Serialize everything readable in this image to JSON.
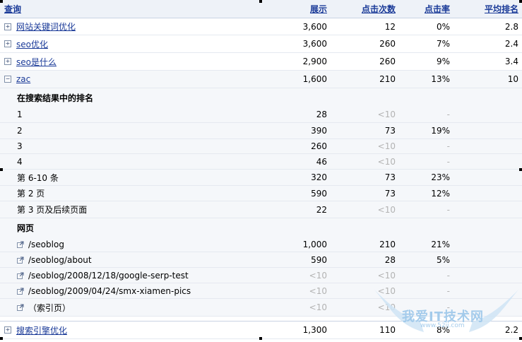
{
  "header": {
    "query": "查询",
    "impressions": "展示",
    "clicks": "点击次数",
    "ctr": "点击率",
    "avg_position": "平均排名"
  },
  "queries_top": [
    {
      "label": "网站关键词优化",
      "impressions": "3,600",
      "clicks": "12",
      "ctr": "0%",
      "avg": "2.8"
    },
    {
      "label": "seo优化",
      "impressions": "3,600",
      "clicks": "260",
      "ctr": "7%",
      "avg": "2.4"
    },
    {
      "label": "seo是什么",
      "impressions": "2,900",
      "clicks": "260",
      "ctr": "9%",
      "avg": "3.4"
    },
    {
      "label": "zac",
      "impressions": "1,600",
      "clicks": "210",
      "ctr": "13%",
      "avg": "10"
    }
  ],
  "ranking_section": {
    "title": "在搜索结果中的排名",
    "rows": [
      {
        "label": "1",
        "impressions": "28",
        "clicks": "<10",
        "ctr": "-"
      },
      {
        "label": "2",
        "impressions": "390",
        "clicks": "73",
        "ctr": "19%"
      },
      {
        "label": "3",
        "impressions": "260",
        "clicks": "<10",
        "ctr": "-"
      },
      {
        "label": "4",
        "impressions": "46",
        "clicks": "<10",
        "ctr": "-"
      },
      {
        "label": "第 6-10 条",
        "impressions": "320",
        "clicks": "73",
        "ctr": "23%"
      },
      {
        "label": "第 2 页",
        "impressions": "590",
        "clicks": "73",
        "ctr": "12%"
      },
      {
        "label": "第 3 页及后续页面",
        "impressions": "22",
        "clicks": "<10",
        "ctr": "-"
      }
    ]
  },
  "pages_section": {
    "title": "网页",
    "rows": [
      {
        "label": "/seoblog",
        "impressions": "1,000",
        "clicks": "210",
        "ctr": "21%"
      },
      {
        "label": "/seoblog/about",
        "impressions": "590",
        "clicks": "28",
        "ctr": "5%"
      },
      {
        "label": "/seoblog/2008/12/18/google-serp-test",
        "impressions": "<10",
        "clicks": "<10",
        "ctr": "-"
      },
      {
        "label": "/seoblog/2009/04/24/smx-xiamen-pics",
        "impressions": "<10",
        "clicks": "<10",
        "ctr": "-"
      },
      {
        "label": "（索引页）",
        "impressions": "<10",
        "clicks": "<10",
        "ctr": "-"
      }
    ]
  },
  "queries_bottom": [
    {
      "label": "搜索引擎优化",
      "impressions": "1,300",
      "clicks": "110",
      "ctr": "8%",
      "avg": "2.2"
    }
  ],
  "watermark": {
    "text": "我爱IT技术网",
    "url": "www.52ij.com"
  },
  "colors": {
    "link": "#1a3a98",
    "header_bg": "#eef2f8",
    "alt_row_bg": "#f5f7fa",
    "row_border": "#e5e9f0",
    "muted": "#b3b3b3"
  }
}
